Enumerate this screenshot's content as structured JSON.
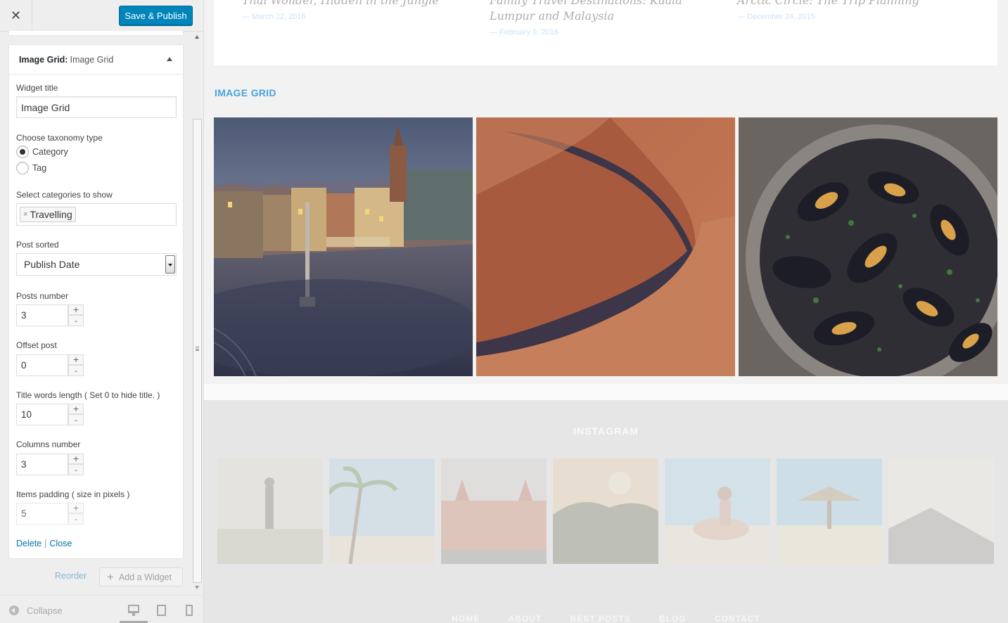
{
  "toolbar": {
    "publish_label": "Save & Publish",
    "close_symbol": "✕"
  },
  "widget": {
    "header_type": "Image Grid:",
    "header_title": "Image Grid",
    "widget_title_label": "Widget title",
    "widget_title_value": "Image Grid",
    "taxonomy_label": "Choose taxonomy type",
    "taxonomy_options": [
      "Category",
      "Tag"
    ],
    "taxonomy_selected": "Category",
    "categories_label": "Select categories to show",
    "categories_selected": [
      "Travelling"
    ],
    "tag_remove_symbol": "×",
    "sorted_label": "Post sorted",
    "sorted_value": "Publish Date",
    "posts_number_label": "Posts number",
    "posts_number_value": "3",
    "offset_label": "Offset post",
    "offset_value": "0",
    "title_length_label": "Title words length ( Set 0 to hide title. )",
    "title_length_value": "10",
    "columns_label": "Columns number",
    "columns_value": "3",
    "padding_label": "Items padding ( size in pixels )",
    "padding_value": "5",
    "stepper_plus": "+",
    "stepper_minus": "-",
    "delete_label": "Delete",
    "close_label": "Close",
    "separator": "|"
  },
  "panel_footer": {
    "reorder_label": "Reorder",
    "add_widget_label": "Add a Widget",
    "add_widget_symbol": "+",
    "collapse_label": "Collapse"
  },
  "preview": {
    "posts": [
      {
        "title": "Thai Wonder, Hidden in the Jungle",
        "date": "March 22, 2016"
      },
      {
        "title": "Family Travel Destinations: Kuala Lumpur and Malaysia",
        "date": "February 9, 2016"
      },
      {
        "title": "Arctic Circle: The Trip Planning",
        "date": "December 24, 2015"
      }
    ],
    "image_grid_heading": "IMAGE GRID",
    "instagram_heading": "INSTAGRAM",
    "footer_nav": [
      "HOME",
      "ABOUT",
      "BEST POSTS",
      "BLOG",
      "CONTACT"
    ]
  },
  "colors": {
    "publish_button": "#0085ba",
    "link": "#0073aa",
    "accent_heading": "#4aa3e0"
  }
}
